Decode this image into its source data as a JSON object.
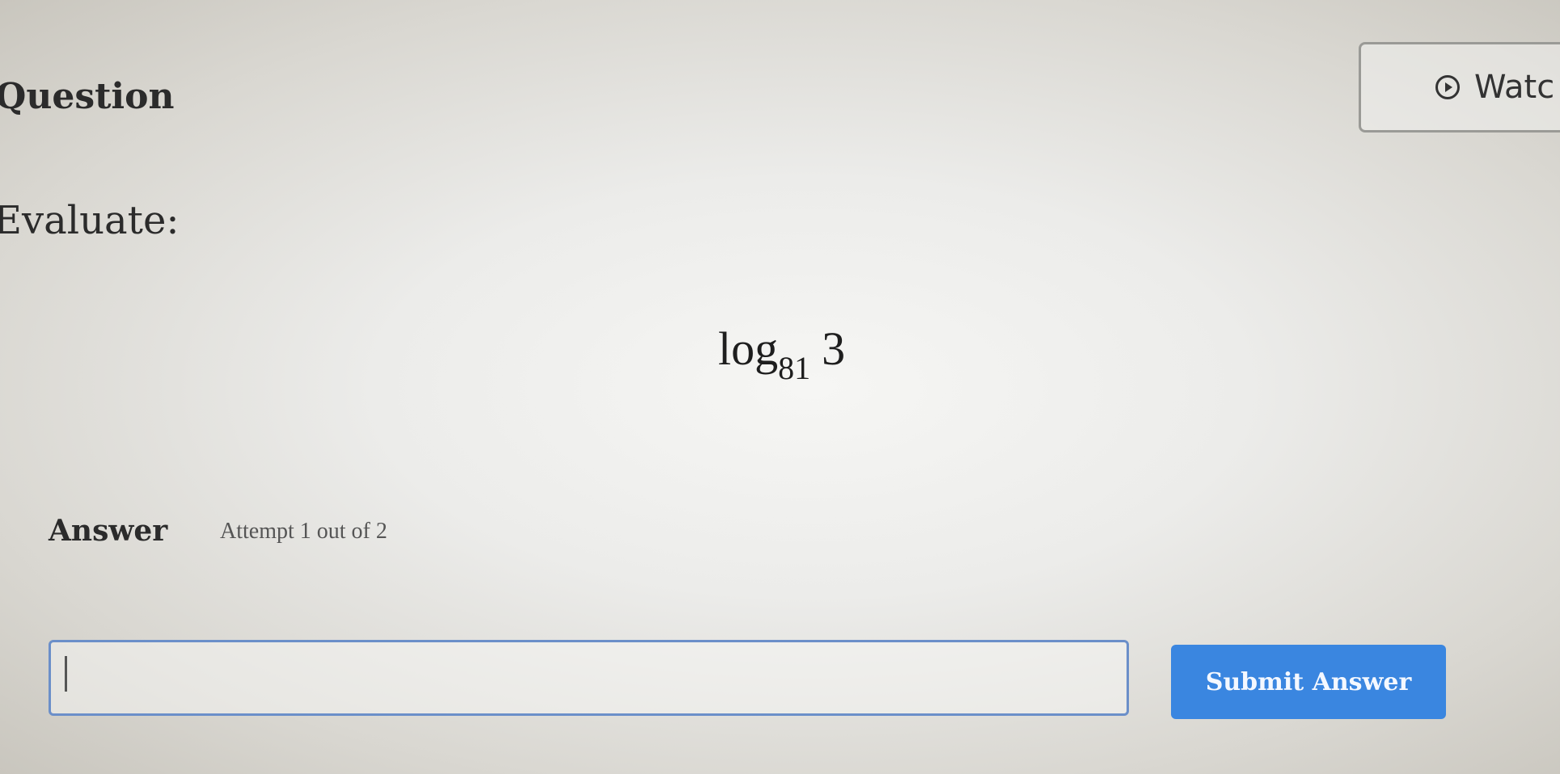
{
  "question": {
    "title": "Question",
    "watch_label": "Watc"
  },
  "prompt": "Evaluate:",
  "expression": {
    "func": "log",
    "base": "81",
    "argument": "3"
  },
  "answer": {
    "label": "Answer",
    "attempt_text": "Attempt 1 out of 2",
    "input_value": "",
    "submit_label": "Submit Answer"
  },
  "colors": {
    "submit_button": "#3a86e0",
    "input_border": "#6b8fc9"
  },
  "icons": {
    "watch": "play-circle-icon"
  }
}
